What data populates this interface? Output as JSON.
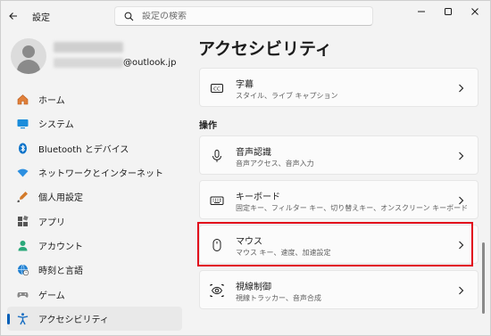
{
  "window": {
    "title": "設定"
  },
  "search": {
    "placeholder": "設定の検索"
  },
  "profile": {
    "email_suffix": "@outlook.jp"
  },
  "nav": {
    "items": [
      {
        "label": "ホーム",
        "icon": "home-icon"
      },
      {
        "label": "システム",
        "icon": "system-icon"
      },
      {
        "label": "Bluetooth とデバイス",
        "icon": "bluetooth-icon"
      },
      {
        "label": "ネットワークとインターネット",
        "icon": "network-icon"
      },
      {
        "label": "個人用設定",
        "icon": "personalization-icon"
      },
      {
        "label": "アプリ",
        "icon": "apps-icon"
      },
      {
        "label": "アカウント",
        "icon": "account-icon"
      },
      {
        "label": "時刻と言語",
        "icon": "time-language-icon"
      },
      {
        "label": "ゲーム",
        "icon": "gaming-icon"
      },
      {
        "label": "アクセシビリティ",
        "icon": "accessibility-icon"
      }
    ],
    "active_index": 9
  },
  "main": {
    "title": "アクセシビリティ",
    "section_label": "操作",
    "cards": [
      {
        "title": "字幕",
        "subtitle": "スタイル、ライブ キャプション",
        "icon": "captions-icon"
      },
      {
        "title": "音声認識",
        "subtitle": "音声アクセス、音声入力",
        "icon": "microphone-icon"
      },
      {
        "title": "キーボード",
        "subtitle": "固定キー、フィルター キー、切り替えキー、オンスクリーン キーボード",
        "icon": "keyboard-icon"
      },
      {
        "title": "マウス",
        "subtitle": "マウス キー、速度、加速設定",
        "icon": "mouse-icon"
      },
      {
        "title": "視線制御",
        "subtitle": "視線トラッカー、音声合成",
        "icon": "eye-control-icon"
      }
    ],
    "highlighted_card": "マウス"
  },
  "colors": {
    "accent": "#005fb8",
    "highlight": "#e1001a",
    "background": "#f3f3f3"
  }
}
